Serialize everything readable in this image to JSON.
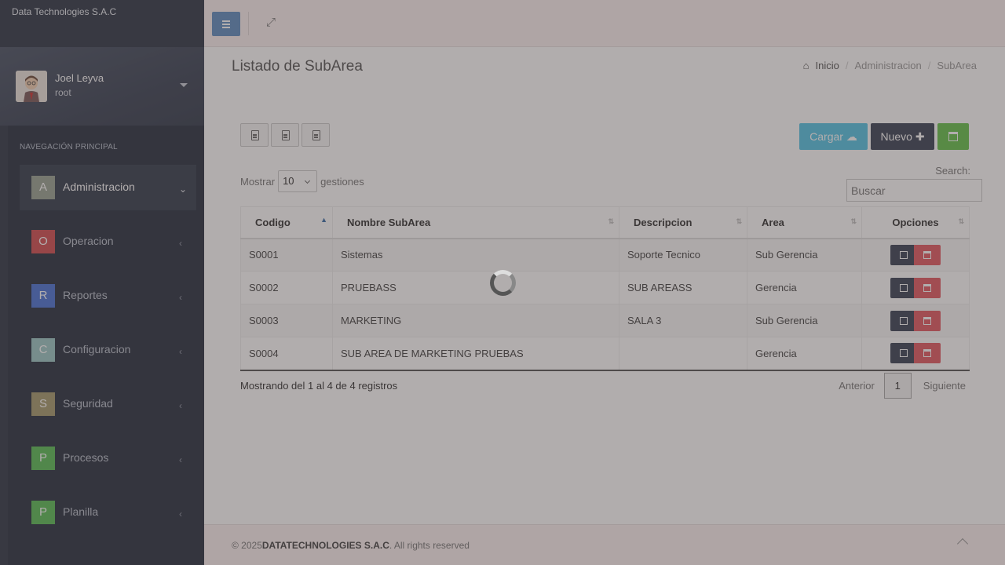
{
  "app": {
    "brand": "Data Technologies S.A.C"
  },
  "user": {
    "name": "Joel Leyva",
    "role": "root"
  },
  "sidebar": {
    "header": "NAVEGACIÓN PRINCIPAL",
    "items": [
      {
        "letter": "A",
        "label": "Administracion",
        "color": "#9aa494",
        "chevron": "⌄"
      },
      {
        "letter": "O",
        "label": "Operacion",
        "color": "#d34f52",
        "chevron": "‹"
      },
      {
        "letter": "R",
        "label": "Reportes",
        "color": "#4a74d6",
        "chevron": "‹"
      },
      {
        "letter": "C",
        "label": "Configuracion",
        "color": "#9cc9c7",
        "chevron": "‹"
      },
      {
        "letter": "S",
        "label": "Seguridad",
        "color": "#a69c6f",
        "chevron": "‹"
      },
      {
        "letter": "P",
        "label": "Procesos",
        "color": "#5bbd56",
        "chevron": "‹"
      },
      {
        "letter": "P",
        "label": "Planilla",
        "color": "#5bbd56",
        "chevron": "‹"
      }
    ]
  },
  "page": {
    "title": "Listado de SubArea",
    "breadcrumb": [
      "Inicio",
      "Administracion",
      "SubArea"
    ]
  },
  "toolbar": {
    "cargar_label": "Cargar",
    "nuevo_label": "Nuevo"
  },
  "table_controls": {
    "show_prefix": "Mostrar",
    "show_value": "10",
    "show_suffix": "gestiones",
    "search_label": "Search:",
    "search_placeholder": "Buscar"
  },
  "table": {
    "columns": [
      "Codigo",
      "Nombre SubArea",
      "Descripcion",
      "Area",
      "Opciones"
    ],
    "rows": [
      [
        "S0001",
        "Sistemas",
        "Soporte Tecnico",
        "Sub Gerencia"
      ],
      [
        "S0002",
        "PRUEBASS",
        "SUB AREASS",
        "Gerencia"
      ],
      [
        "S0003",
        "MARKETING",
        "SALA 3",
        "Sub Gerencia"
      ],
      [
        "S0004",
        "SUB AREA DE MARKETING PRUEBAS",
        "",
        "Gerencia"
      ]
    ]
  },
  "pagination": {
    "info": "Mostrando del 1 al 4 de 4 registros",
    "prev": "Anterior",
    "page": "1",
    "next": "Siguiente"
  },
  "footer": {
    "prefix": "© 2025",
    "company": "DATATECHNOLOGIES S.A.C",
    "suffix": ". All rights reserved"
  }
}
